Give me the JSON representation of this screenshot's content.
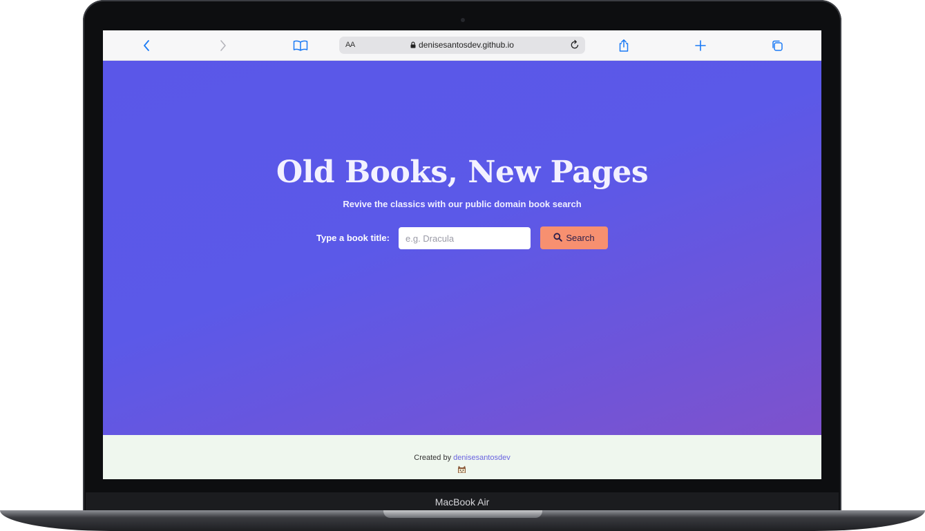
{
  "browser": {
    "text_size_label": "AA",
    "url": "denisesantosdev.github.io",
    "icons": {
      "back": "chevron-left-icon",
      "forward": "chevron-right-icon",
      "bookmarks": "book-open-icon",
      "lock": "lock-icon",
      "reload": "reload-icon",
      "share": "share-icon",
      "new_tab": "plus-icon",
      "tabs": "tabs-overview-icon"
    },
    "accent_color": "#1a7af5"
  },
  "hero": {
    "title": "Old Books, New Pages",
    "subtitle": "Revive the classics with our public domain book search",
    "search_label": "Type a book title:",
    "search_placeholder": "e.g. Dracula",
    "search_value": "",
    "search_button_label": "Search",
    "search_icon": "search-icon",
    "gradient_colors": [
      "#5a57e8",
      "#7e52cc"
    ],
    "button_color": "#f79070"
  },
  "footer": {
    "created_by_text": "Created by",
    "author_link": "denisesantosdev",
    "emoji_icon": "cat-face-emoji-icon",
    "background_color": "#eff7ee"
  },
  "device": {
    "label": "MacBook Air"
  }
}
